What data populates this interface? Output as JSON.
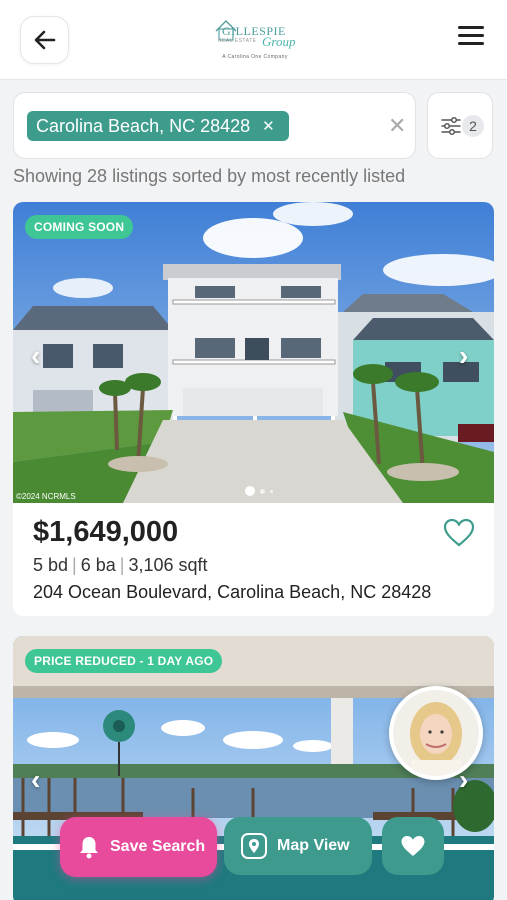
{
  "header": {
    "logo": {
      "name": "GILLESPIE",
      "subname": "REAL ESTATE",
      "script": "Group",
      "tagline": "A Carolina One Company"
    }
  },
  "search": {
    "chip_label": "Carolina Beach, NC 28428",
    "filter_count": "2"
  },
  "summary": "Showing 28 listings sorted by most recently listed",
  "listings": [
    {
      "badge": "COMING SOON",
      "copyright": "©2024 NCRMLS",
      "price": "$1,649,000",
      "beds": "5 bd",
      "baths": "6 ba",
      "sqft": "3,106 sqft",
      "address": "204 Ocean Boulevard, Carolina Beach, NC 28428"
    },
    {
      "badge": "PRICE REDUCED - 1 DAY AGO"
    }
  ],
  "actions": {
    "save_search": "Save Search",
    "map_view": "Map View"
  },
  "colors": {
    "brand_teal": "#3e9c8d",
    "badge_green": "#3ec694",
    "save_pink": "#e84a9c"
  }
}
